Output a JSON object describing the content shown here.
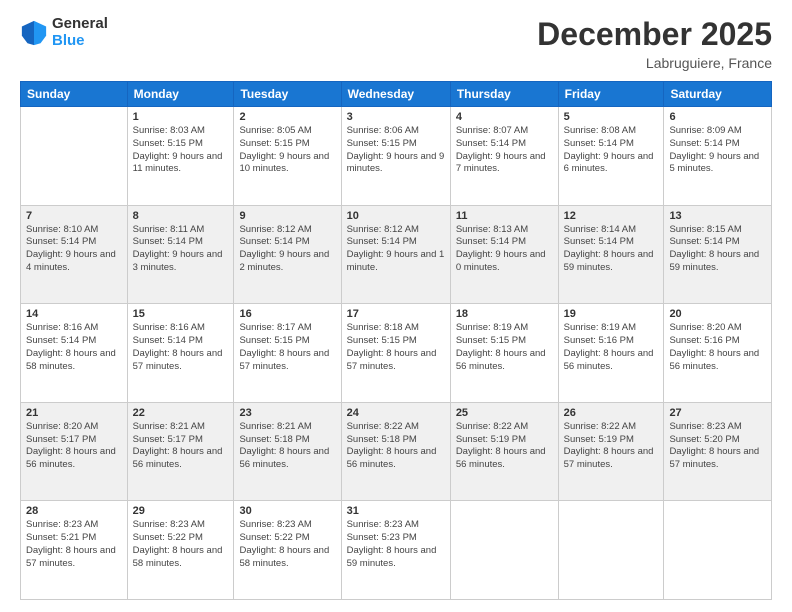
{
  "logo": {
    "general": "General",
    "blue": "Blue"
  },
  "header": {
    "month": "December 2025",
    "location": "Labruguiere, France"
  },
  "weekdays": [
    "Sunday",
    "Monday",
    "Tuesday",
    "Wednesday",
    "Thursday",
    "Friday",
    "Saturday"
  ],
  "weeks": [
    [
      {
        "day": "",
        "sunrise": "",
        "sunset": "",
        "daylight": ""
      },
      {
        "day": "1",
        "sunrise": "Sunrise: 8:03 AM",
        "sunset": "Sunset: 5:15 PM",
        "daylight": "Daylight: 9 hours and 11 minutes."
      },
      {
        "day": "2",
        "sunrise": "Sunrise: 8:05 AM",
        "sunset": "Sunset: 5:15 PM",
        "daylight": "Daylight: 9 hours and 10 minutes."
      },
      {
        "day": "3",
        "sunrise": "Sunrise: 8:06 AM",
        "sunset": "Sunset: 5:15 PM",
        "daylight": "Daylight: 9 hours and 9 minutes."
      },
      {
        "day": "4",
        "sunrise": "Sunrise: 8:07 AM",
        "sunset": "Sunset: 5:14 PM",
        "daylight": "Daylight: 9 hours and 7 minutes."
      },
      {
        "day": "5",
        "sunrise": "Sunrise: 8:08 AM",
        "sunset": "Sunset: 5:14 PM",
        "daylight": "Daylight: 9 hours and 6 minutes."
      },
      {
        "day": "6",
        "sunrise": "Sunrise: 8:09 AM",
        "sunset": "Sunset: 5:14 PM",
        "daylight": "Daylight: 9 hours and 5 minutes."
      }
    ],
    [
      {
        "day": "7",
        "sunrise": "Sunrise: 8:10 AM",
        "sunset": "Sunset: 5:14 PM",
        "daylight": "Daylight: 9 hours and 4 minutes."
      },
      {
        "day": "8",
        "sunrise": "Sunrise: 8:11 AM",
        "sunset": "Sunset: 5:14 PM",
        "daylight": "Daylight: 9 hours and 3 minutes."
      },
      {
        "day": "9",
        "sunrise": "Sunrise: 8:12 AM",
        "sunset": "Sunset: 5:14 PM",
        "daylight": "Daylight: 9 hours and 2 minutes."
      },
      {
        "day": "10",
        "sunrise": "Sunrise: 8:12 AM",
        "sunset": "Sunset: 5:14 PM",
        "daylight": "Daylight: 9 hours and 1 minute."
      },
      {
        "day": "11",
        "sunrise": "Sunrise: 8:13 AM",
        "sunset": "Sunset: 5:14 PM",
        "daylight": "Daylight: 9 hours and 0 minutes."
      },
      {
        "day": "12",
        "sunrise": "Sunrise: 8:14 AM",
        "sunset": "Sunset: 5:14 PM",
        "daylight": "Daylight: 8 hours and 59 minutes."
      },
      {
        "day": "13",
        "sunrise": "Sunrise: 8:15 AM",
        "sunset": "Sunset: 5:14 PM",
        "daylight": "Daylight: 8 hours and 59 minutes."
      }
    ],
    [
      {
        "day": "14",
        "sunrise": "Sunrise: 8:16 AM",
        "sunset": "Sunset: 5:14 PM",
        "daylight": "Daylight: 8 hours and 58 minutes."
      },
      {
        "day": "15",
        "sunrise": "Sunrise: 8:16 AM",
        "sunset": "Sunset: 5:14 PM",
        "daylight": "Daylight: 8 hours and 57 minutes."
      },
      {
        "day": "16",
        "sunrise": "Sunrise: 8:17 AM",
        "sunset": "Sunset: 5:15 PM",
        "daylight": "Daylight: 8 hours and 57 minutes."
      },
      {
        "day": "17",
        "sunrise": "Sunrise: 8:18 AM",
        "sunset": "Sunset: 5:15 PM",
        "daylight": "Daylight: 8 hours and 57 minutes."
      },
      {
        "day": "18",
        "sunrise": "Sunrise: 8:19 AM",
        "sunset": "Sunset: 5:15 PM",
        "daylight": "Daylight: 8 hours and 56 minutes."
      },
      {
        "day": "19",
        "sunrise": "Sunrise: 8:19 AM",
        "sunset": "Sunset: 5:16 PM",
        "daylight": "Daylight: 8 hours and 56 minutes."
      },
      {
        "day": "20",
        "sunrise": "Sunrise: 8:20 AM",
        "sunset": "Sunset: 5:16 PM",
        "daylight": "Daylight: 8 hours and 56 minutes."
      }
    ],
    [
      {
        "day": "21",
        "sunrise": "Sunrise: 8:20 AM",
        "sunset": "Sunset: 5:17 PM",
        "daylight": "Daylight: 8 hours and 56 minutes."
      },
      {
        "day": "22",
        "sunrise": "Sunrise: 8:21 AM",
        "sunset": "Sunset: 5:17 PM",
        "daylight": "Daylight: 8 hours and 56 minutes."
      },
      {
        "day": "23",
        "sunrise": "Sunrise: 8:21 AM",
        "sunset": "Sunset: 5:18 PM",
        "daylight": "Daylight: 8 hours and 56 minutes."
      },
      {
        "day": "24",
        "sunrise": "Sunrise: 8:22 AM",
        "sunset": "Sunset: 5:18 PM",
        "daylight": "Daylight: 8 hours and 56 minutes."
      },
      {
        "day": "25",
        "sunrise": "Sunrise: 8:22 AM",
        "sunset": "Sunset: 5:19 PM",
        "daylight": "Daylight: 8 hours and 56 minutes."
      },
      {
        "day": "26",
        "sunrise": "Sunrise: 8:22 AM",
        "sunset": "Sunset: 5:19 PM",
        "daylight": "Daylight: 8 hours and 57 minutes."
      },
      {
        "day": "27",
        "sunrise": "Sunrise: 8:23 AM",
        "sunset": "Sunset: 5:20 PM",
        "daylight": "Daylight: 8 hours and 57 minutes."
      }
    ],
    [
      {
        "day": "28",
        "sunrise": "Sunrise: 8:23 AM",
        "sunset": "Sunset: 5:21 PM",
        "daylight": "Daylight: 8 hours and 57 minutes."
      },
      {
        "day": "29",
        "sunrise": "Sunrise: 8:23 AM",
        "sunset": "Sunset: 5:22 PM",
        "daylight": "Daylight: 8 hours and 58 minutes."
      },
      {
        "day": "30",
        "sunrise": "Sunrise: 8:23 AM",
        "sunset": "Sunset: 5:22 PM",
        "daylight": "Daylight: 8 hours and 58 minutes."
      },
      {
        "day": "31",
        "sunrise": "Sunrise: 8:23 AM",
        "sunset": "Sunset: 5:23 PM",
        "daylight": "Daylight: 8 hours and 59 minutes."
      },
      {
        "day": "",
        "sunrise": "",
        "sunset": "",
        "daylight": ""
      },
      {
        "day": "",
        "sunrise": "",
        "sunset": "",
        "daylight": ""
      },
      {
        "day": "",
        "sunrise": "",
        "sunset": "",
        "daylight": ""
      }
    ]
  ]
}
